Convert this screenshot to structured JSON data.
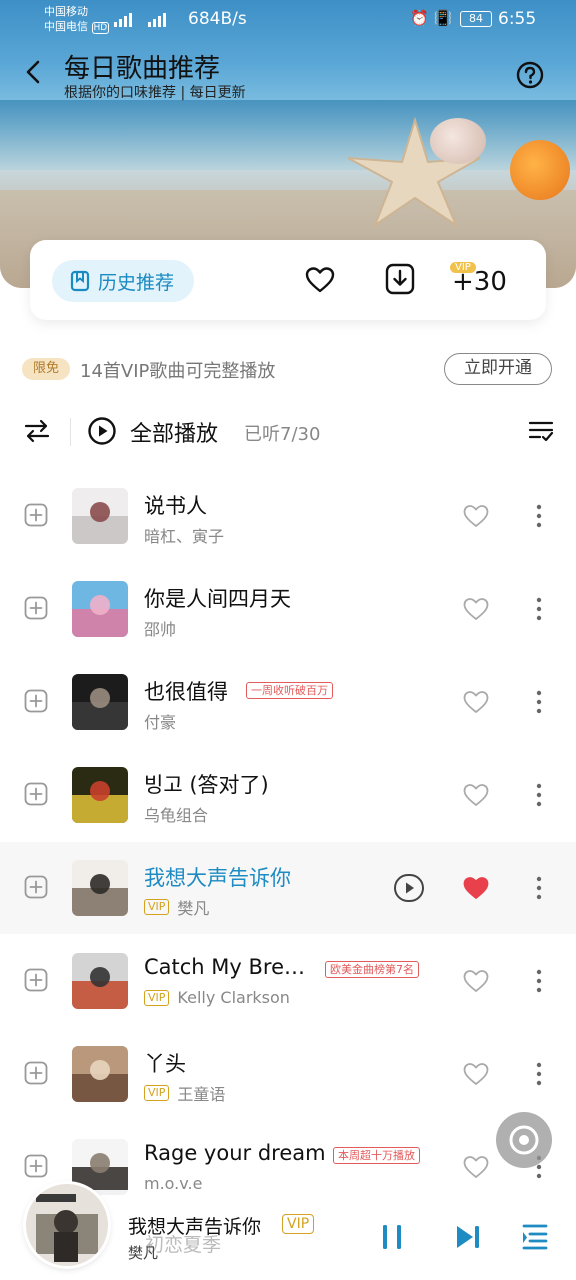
{
  "status": {
    "carrier1": "中国移动",
    "carrier2": "中国电信",
    "hd": "HD",
    "speed": "684B/s",
    "battery": "84",
    "time": "6:55"
  },
  "header": {
    "title": "每日歌曲推荐",
    "subtitle": "根据你的口味推荐 | 每日更新"
  },
  "actions": {
    "history_label": "历史推荐",
    "plus30": "+30",
    "plus30_vip": "VIP"
  },
  "vip_notice": {
    "free_tag": "限免",
    "text": "14首VIP歌曲可完整播放",
    "open_button": "立即开通"
  },
  "playbar": {
    "play_all": "全部播放",
    "heard": "已听7/30"
  },
  "songs": [
    {
      "name": "说书人",
      "artist": "暗杠、寅子",
      "vip": false,
      "tag": "",
      "liked": false
    },
    {
      "name": "你是人间四月天",
      "artist": "邵帅",
      "vip": false,
      "tag": "",
      "liked": false
    },
    {
      "name": "也很值得",
      "artist": "付豪",
      "vip": false,
      "tag": "一周收听破百万",
      "liked": false
    },
    {
      "name": "빙고 (答对了)",
      "artist": "乌龟组合",
      "vip": false,
      "tag": "",
      "liked": false
    },
    {
      "name": "我想大声告诉你",
      "artist": "樊凡",
      "vip": true,
      "tag": "",
      "liked": true
    },
    {
      "name": "Catch My Bre…",
      "artist": "Kelly Clarkson",
      "vip": true,
      "tag": "欧美金曲榜第7名",
      "liked": false
    },
    {
      "name": "丫头",
      "artist": "王童语",
      "vip": true,
      "tag": "",
      "liked": false
    },
    {
      "name": "Rage your dream",
      "artist": "m.o.v.e",
      "vip": false,
      "tag": "本周超十万播放",
      "liked": false
    }
  ],
  "vip_label": "VIP",
  "mini_player": {
    "title": "我想大声告诉你",
    "vip": "VIP",
    "artist": "樊凡",
    "behind_text": "初恋夏季"
  },
  "colors": {
    "accent": "#1e8bc3",
    "liked": "#e8414b",
    "vip_gold": "#d4a21e",
    "tag_red": "#e35b5b"
  }
}
